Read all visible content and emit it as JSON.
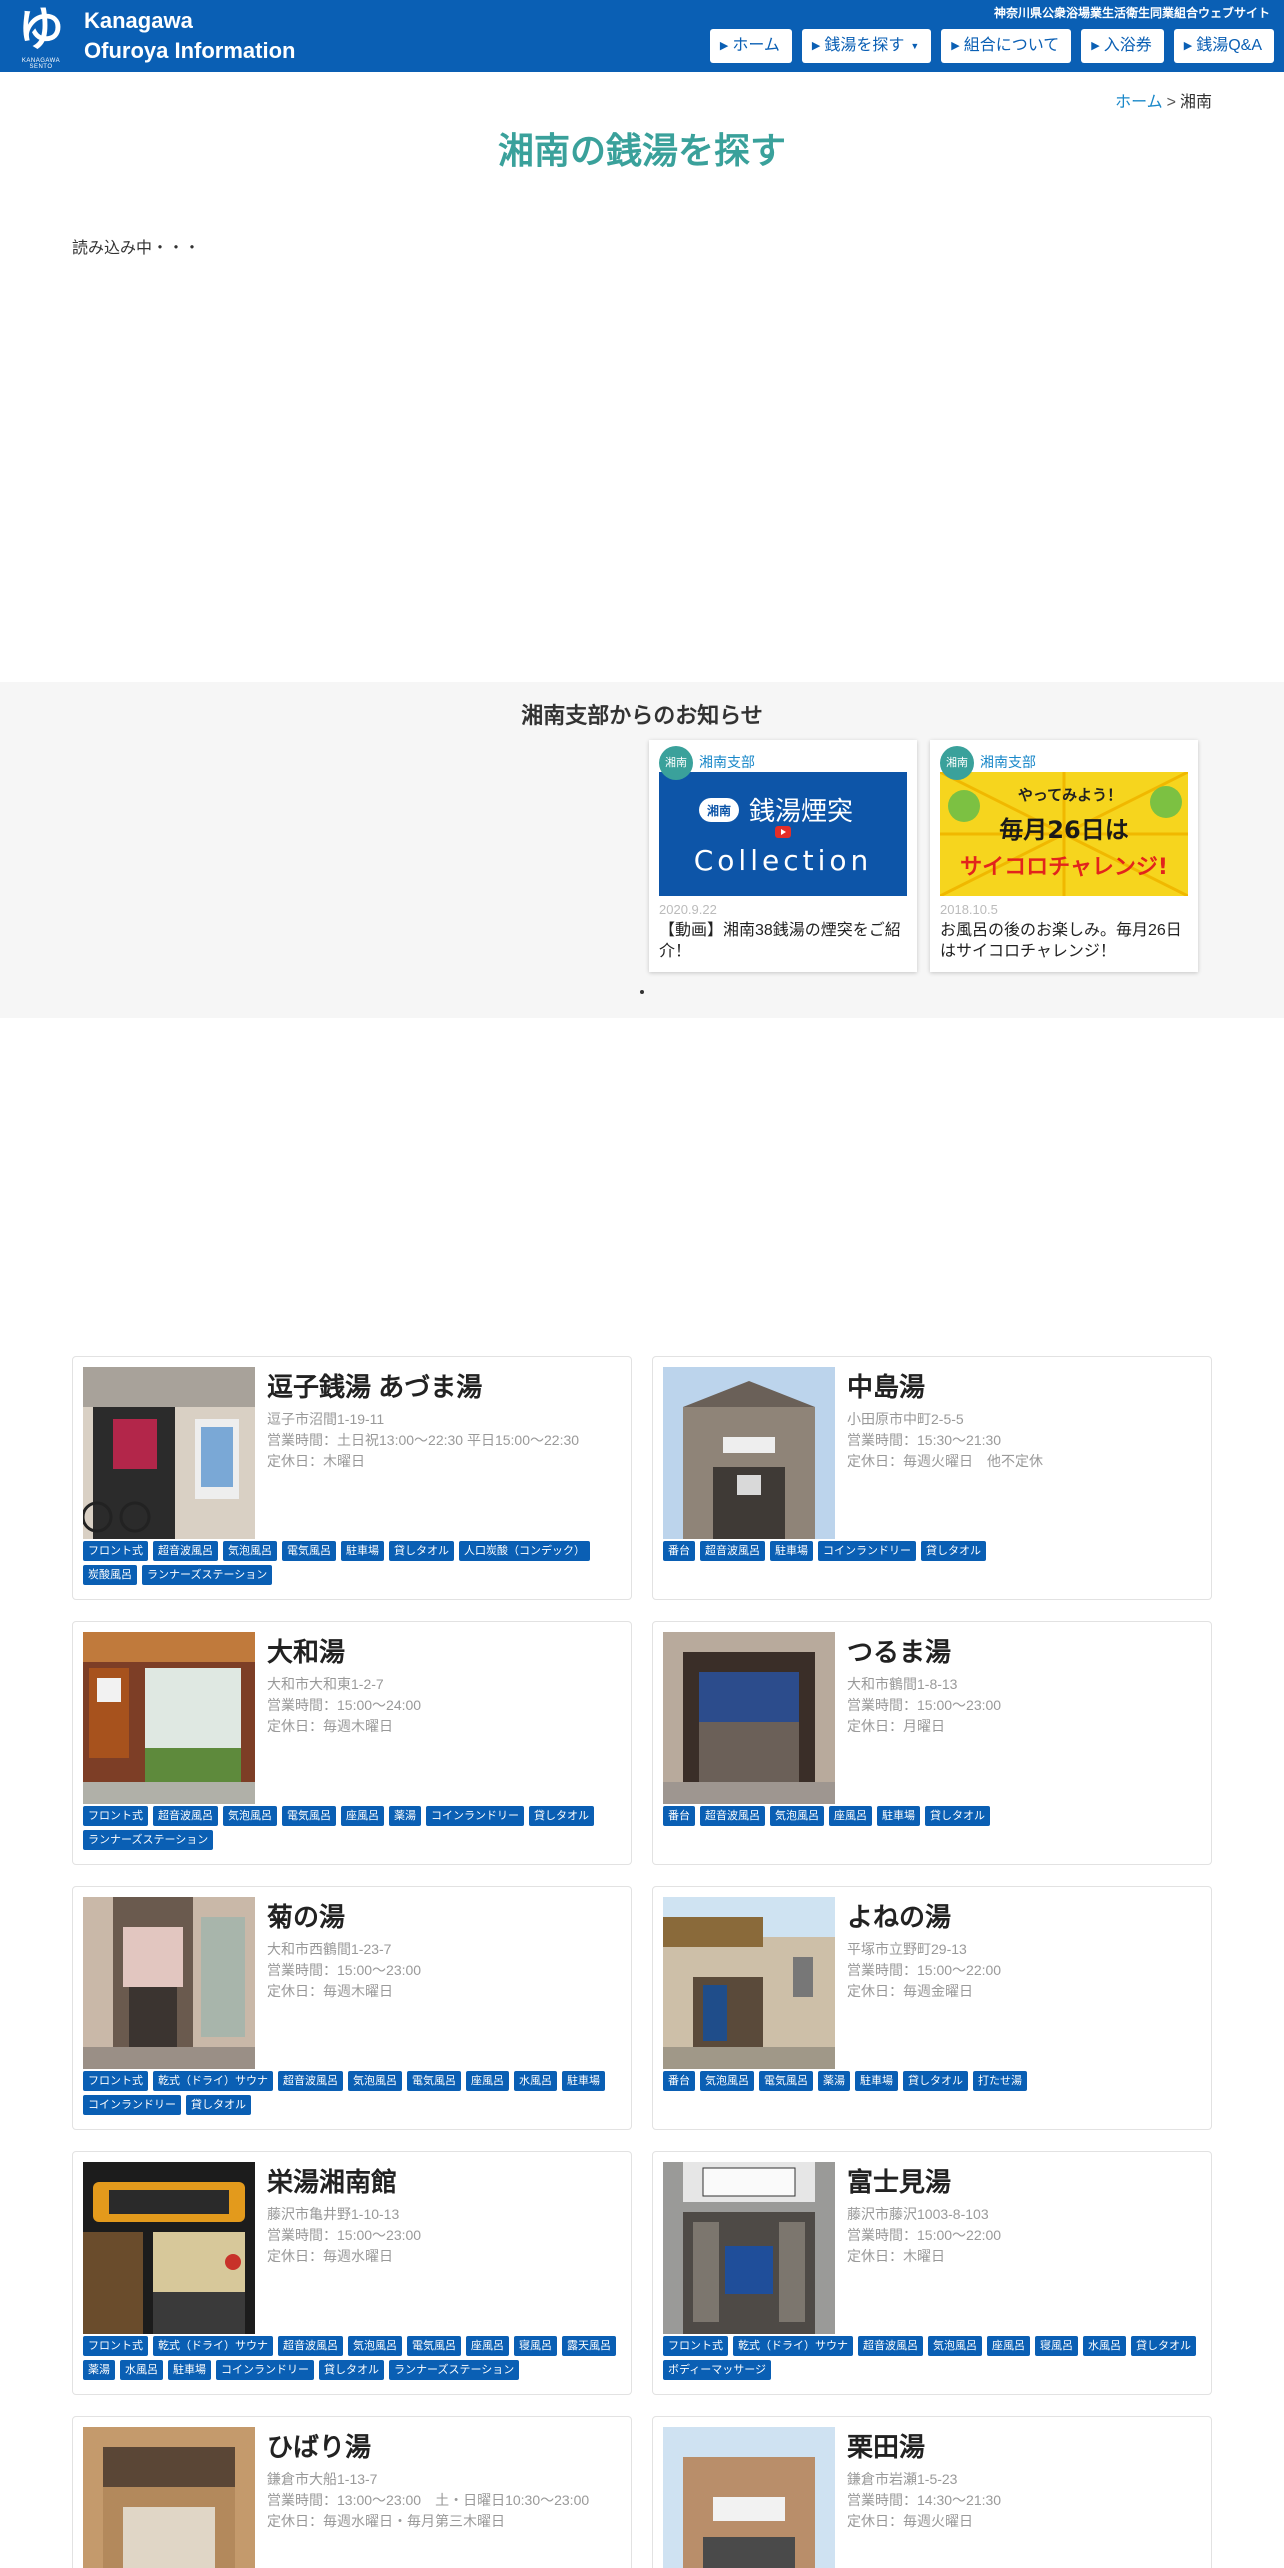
{
  "header": {
    "site_title_line1": "Kanagawa",
    "site_title_line2": "Ofuroya Information",
    "logo_glyph": "ゆ",
    "logo_sub": "KANAGAWA SENTO",
    "tagline": "神奈川県公衆浴場業生活衛生同業組合ウェブサイト",
    "brand_color": "#0a5fb4",
    "nav": [
      {
        "label": "ホーム",
        "dropdown": false
      },
      {
        "label": "銭湯を探す",
        "dropdown": true
      },
      {
        "label": "組合について",
        "dropdown": false
      },
      {
        "label": "入浴券",
        "dropdown": false
      },
      {
        "label": "銭湯Q&A",
        "dropdown": false
      }
    ]
  },
  "breadcrumb": {
    "home": "ホーム",
    "separator": ">",
    "current": "湘南"
  },
  "page": {
    "title": "湘南の銭湯を探す",
    "loading_text": "読み込み中・・・",
    "accent_color": "#3aa19b"
  },
  "news": {
    "title": "湘南支部からのお知らせ",
    "items": [
      {
        "badge": "湘南",
        "branch": "湘南支部",
        "date": "2020.9.22",
        "text": "【動画】湘南38銭湯の煙突をご紹介！",
        "thumb_line1": "湘南",
        "thumb_line2": "銭湯煙突",
        "thumb_line3": "Collection"
      },
      {
        "badge": "湘南",
        "branch": "湘南支部",
        "date": "2018.10.5",
        "text": "お風呂の後のお楽しみ。毎月26日はサイコロチャレンジ！",
        "thumb_line1": "やってみよう！",
        "thumb_line2": "毎月26日は",
        "thumb_line3": "サイコロチャレンジ!"
      }
    ]
  },
  "sento": [
    {
      "name": "逗子銭湯 あづま湯",
      "address": "逗子市沼間1-19-11",
      "hours": "営業時間：土日祝13:00～22:30 平日15:00～22:30",
      "closed": "定休日：木曜日",
      "tags": [
        "フロント式",
        "超音波風呂",
        "気泡風呂",
        "電気風呂",
        "駐車場",
        "貸しタオル",
        "人口炭酸（コンデック）",
        "炭酸風呂",
        "ランナーズステーション"
      ]
    },
    {
      "name": "中島湯",
      "address": "小田原市中町2-5-5",
      "hours": "営業時間：15:30〜21:30",
      "closed": "定休日：毎週火曜日　他不定休",
      "tags": [
        "番台",
        "超音波風呂",
        "駐車場",
        "コインランドリー",
        "貸しタオル"
      ]
    },
    {
      "name": "大和湯",
      "address": "大和市大和東1-2-7",
      "hours": "営業時間：15:00〜24:00",
      "closed": "定休日：毎週木曜日",
      "tags": [
        "フロント式",
        "超音波風呂",
        "気泡風呂",
        "電気風呂",
        "座風呂",
        "薬湯",
        "コインランドリー",
        "貸しタオル",
        "ランナーズステーション"
      ]
    },
    {
      "name": "つるま湯",
      "address": "大和市鶴間1-8-13",
      "hours": "営業時間：15:00〜23:00",
      "closed": "定休日：月曜日",
      "tags": [
        "番台",
        "超音波風呂",
        "気泡風呂",
        "座風呂",
        "駐車場",
        "貸しタオル"
      ]
    },
    {
      "name": "菊の湯",
      "address": "大和市西鶴間1-23-7",
      "hours": "営業時間：15:00〜23:00",
      "closed": "定休日：毎週木曜日",
      "tags": [
        "フロント式",
        "乾式（ドライ）サウナ",
        "超音波風呂",
        "気泡風呂",
        "電気風呂",
        "座風呂",
        "水風呂",
        "駐車場",
        "コインランドリー",
        "貸しタオル"
      ]
    },
    {
      "name": "よねの湯",
      "address": "平塚市立野町29-13",
      "hours": "営業時間：15:00〜22:00",
      "closed": "定休日：毎週金曜日",
      "tags": [
        "番台",
        "気泡風呂",
        "電気風呂",
        "薬湯",
        "駐車場",
        "貸しタオル",
        "打たせ湯"
      ]
    },
    {
      "name": "栄湯湘南館",
      "address": "藤沢市亀井野1-10-13",
      "hours": "営業時間：15:00〜23:00",
      "closed": "定休日：毎週水曜日",
      "tags": [
        "フロント式",
        "乾式（ドライ）サウナ",
        "超音波風呂",
        "気泡風呂",
        "電気風呂",
        "座風呂",
        "寝風呂",
        "露天風呂",
        "薬湯",
        "水風呂",
        "駐車場",
        "コインランドリー",
        "貸しタオル",
        "ランナーズステーション"
      ]
    },
    {
      "name": "富士見湯",
      "address": "藤沢市藤沢1003-8-103",
      "hours": "営業時間：15:00〜22:00",
      "closed": "定休日：木曜日",
      "tags": [
        "フロント式",
        "乾式（ドライ）サウナ",
        "超音波風呂",
        "気泡風呂",
        "座風呂",
        "寝風呂",
        "水風呂",
        "貸しタオル",
        "ボディーマッサージ"
      ]
    },
    {
      "name": "ひばり湯",
      "address": "鎌倉市大船1-13-7",
      "hours": "営業時間：13:00〜23:00　土・日曜日10:30〜23:00",
      "closed": "定休日：毎週水曜日・毎月第三木曜日",
      "tags": []
    },
    {
      "name": "栗田湯",
      "address": "鎌倉市岩瀬1-5-23",
      "hours": "営業時間：14:30〜21:30",
      "closed": "定休日：毎週火曜日",
      "tags": []
    }
  ]
}
